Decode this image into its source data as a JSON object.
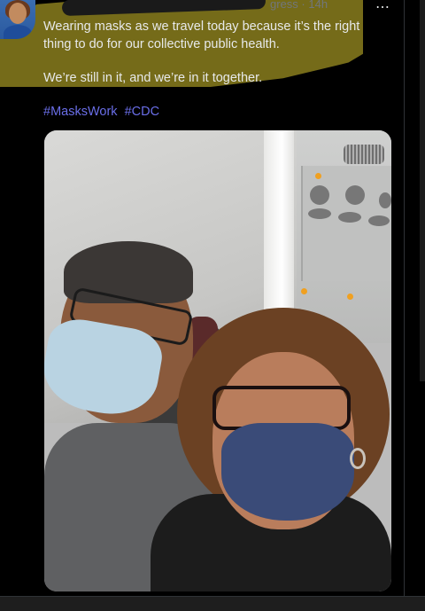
{
  "tweet": {
    "author_avatar": "author-avatar",
    "meta_time": "· 14h",
    "meta_partial": "gress",
    "more_icon": "⋯",
    "text_line1": "Wearing masks as we travel today because it’s the right thing to do for our collective public health.",
    "text_line2": "We’re still in it, and we’re in it together.",
    "hashtags": [
      "#MasksWork",
      "#CDC"
    ]
  },
  "colors": {
    "background": "#000000",
    "text": "#e7e9ea",
    "hashtag": "#6a6ee8",
    "highlight": "#756b19",
    "muted": "#71767b"
  }
}
